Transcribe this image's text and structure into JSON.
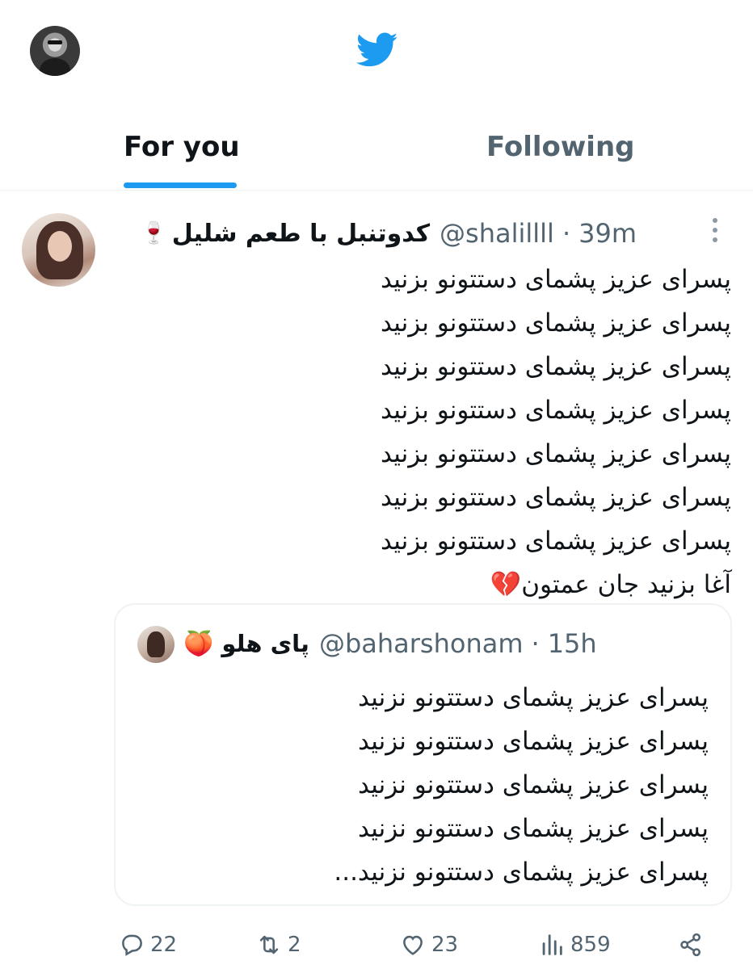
{
  "header": {
    "avatar_icon": "profile-avatar",
    "logo_icon": "twitter-bird-icon",
    "brand_color": "#1d9bf0"
  },
  "tabs": [
    {
      "label": "For you",
      "active": true
    },
    {
      "label": "Following",
      "active": false
    }
  ],
  "tweet": {
    "display_name": "کدوتنبل با طعم شلیل",
    "name_emoji": "🍷",
    "handle": "@shalillll",
    "separator": "·",
    "time": "39m",
    "lines": [
      "پسرای عزیز پشمای دستتونو بزنید",
      "پسرای عزیز پشمای دستتونو  بزنید",
      "پسرای عزیز پشمای دستتونو بزنید",
      "پسرای عزیز پشمای دستتونو بزنید",
      "پسرای عزیز پشمای دستتونو بزنید",
      "پسرای عزیز پشمای دستتونو بزنید",
      "پسرای عزیز پشمای دستتونو بزنید",
      "آغا بزنید جان عمتون💔"
    ],
    "quote": {
      "display_name": "پای هلو",
      "name_emoji": "🍑",
      "handle": "@baharshonam",
      "separator": "·",
      "time": "15h",
      "lines": [
        "پسرای عزیز پشمای دستتونو نزنید",
        "پسرای عزیز پشمای دستتونو نزنید",
        "پسرای عزیز پشمای دستتونو نزنید",
        "پسرای عزیز پشمای دستتونو نزنید",
        "پسرای عزیز پشمای دستتونو نزنید..."
      ]
    },
    "actions": {
      "replies": "22",
      "retweets": "2",
      "likes": "23",
      "views": "859"
    }
  }
}
